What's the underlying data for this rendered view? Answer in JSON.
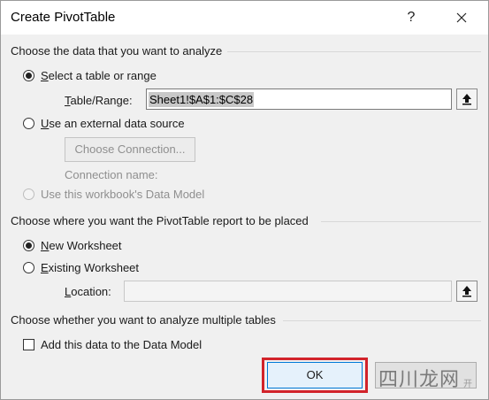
{
  "window": {
    "title": "Create PivotTable",
    "help_glyph": "?",
    "close_glyph": "✕"
  },
  "section_data": {
    "heading": "Choose the data that you want to analyze",
    "options": {
      "select_table": {
        "label_prefix": "",
        "accel": "S",
        "label_rest": "elect a table or range",
        "checked": true
      },
      "external_source": {
        "accel": "U",
        "label_rest": "se an external data source",
        "checked": false
      },
      "data_model": {
        "label": "Use this workbook's Data Model",
        "checked": false,
        "disabled": true
      }
    },
    "table_range": {
      "label_accel": "T",
      "label_rest": "able/Range:",
      "value": "Sheet1!$A$1:$C$28"
    },
    "choose_connection_label": "Choose Connection...",
    "connection_name_label": "Connection name:"
  },
  "section_placement": {
    "heading": "Choose where you want the PivotTable report to be placed",
    "options": {
      "new_worksheet": {
        "accel": "N",
        "label_rest": "ew Worksheet",
        "checked": true
      },
      "existing_worksheet": {
        "accel": "E",
        "label_rest": "xisting Worksheet",
        "checked": false
      }
    },
    "location": {
      "label_accel": "L",
      "label_rest": "ocation:",
      "value": ""
    }
  },
  "section_multiple": {
    "heading": "Choose whether you want to analyze multiple tables",
    "add_to_model": {
      "label": "Add this data to the Data Model",
      "checked": false
    }
  },
  "buttons": {
    "ok_label": "OK",
    "cancel_label": ""
  },
  "watermark": {
    "text": "四川龙网",
    "small": "开"
  },
  "colors": {
    "highlight": "#d2232a",
    "ok_border": "#0078d7"
  }
}
